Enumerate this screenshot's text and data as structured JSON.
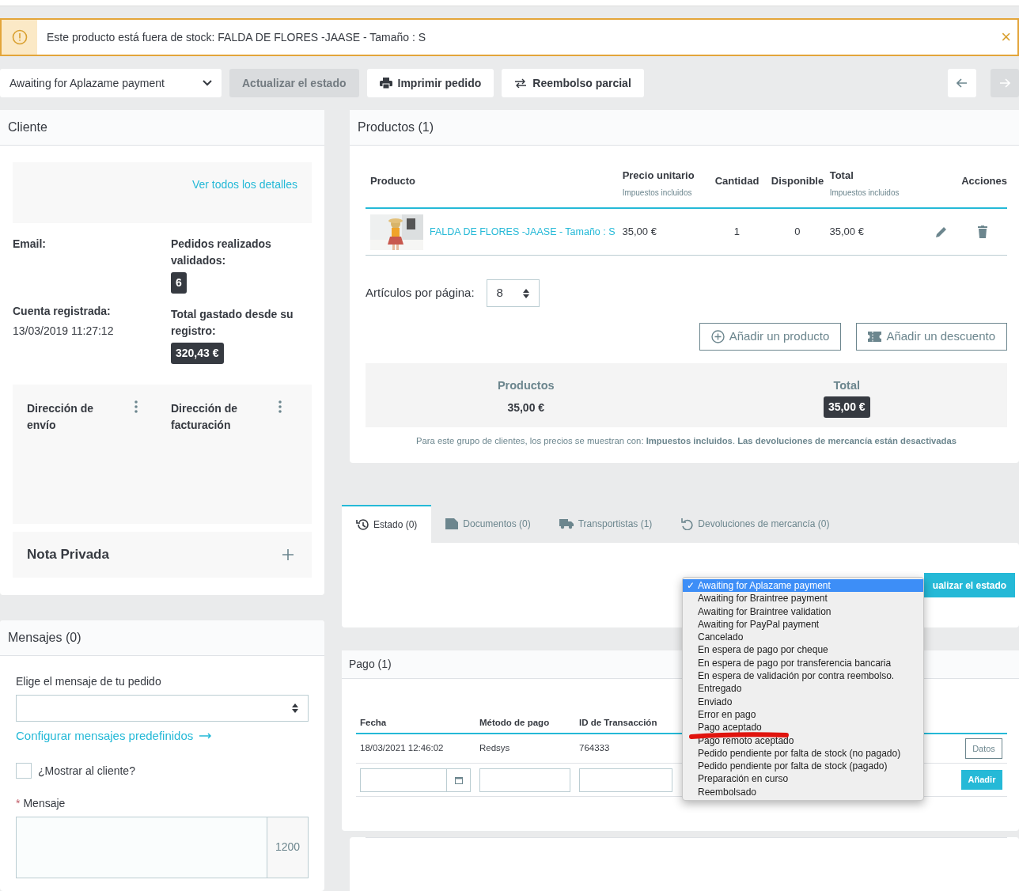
{
  "alert": {
    "text": "Este producto está fuera de stock: FALDA DE FLORES -JAASE - Tamaño : S",
    "close": "×"
  },
  "toolbar": {
    "status_select": "Awaiting for Aplazame payment",
    "update_button": {
      "label": "Actualizar el estado",
      "disabled": true
    },
    "print_button": "Imprimir pedido",
    "refund_button": "Reembolso parcial",
    "nav": [
      {
        "disabled": false
      },
      {
        "disabled": true
      }
    ]
  },
  "customer": {
    "title": "Cliente",
    "details_link": "Ver todos los detalles",
    "email_label": "Email:",
    "registered_label": "Cuenta registrada:",
    "registered_value": "13/03/2019 11:27:12",
    "orders_label": "Pedidos realizados validados:",
    "orders_count": "6",
    "spent_label": "Total gastado desde su registro:",
    "spent_value": "320,43 €",
    "shipping_label": "Dirección de envío",
    "billing_label": "Dirección de facturación",
    "note_label": "Nota Privada"
  },
  "messages": {
    "title": "Mensajes (0)",
    "choose_label": "Elige el mensaje de tu pedido",
    "configure_link": "Configurar mensajes predefinidos",
    "show_customer": {
      "label": "¿Mostrar al cliente?",
      "checked": false
    },
    "required_mark": "*",
    "message_label": "Mensaje",
    "counter": "1200"
  },
  "products": {
    "title": "Productos (1)",
    "columns": [
      {
        "label": "Producto"
      },
      {
        "label": "Precio unitario",
        "sub": "Impuestos incluidos"
      },
      {
        "label": "Cantidad"
      },
      {
        "label": "Disponible"
      },
      {
        "label": "Total",
        "sub": "Impuestos incluidos"
      },
      {
        "label": "Acciones"
      }
    ],
    "rows": [
      {
        "name": "FALDA DE FLORES -JAASE - Tamaño : S",
        "price": "35,00 €",
        "quantity": "1",
        "available": "0",
        "total": "35,00 €"
      }
    ],
    "per_page_label": "Artículos por página:",
    "per_page": "8",
    "add_product": "Añadir un producto",
    "add_discount": "Añadir un descuento",
    "summary": [
      {
        "label": "Productos",
        "value": "35,00 €",
        "kind": "plain"
      },
      {
        "label": "Total",
        "value": "35,00 €",
        "kind": "badge"
      }
    ],
    "note": "Para este grupo de clientes, los precios se muestran con: **Impuestos incluidos**. **Las devoluciones de mercancía están desactivadas**"
  },
  "tabs": [
    {
      "label": "Estado (0)",
      "selected": true
    },
    {
      "label": "Documentos (0)",
      "selected": false
    },
    {
      "label": "Transportistas (1)",
      "selected": false
    },
    {
      "label": "Devoluciones de mercancía (0)",
      "selected": false
    }
  ],
  "status_update_button": "ualizar el estado",
  "status_menu": {
    "selected_mark": "✓",
    "options": [
      {
        "label": "Awaiting for Aplazame payment",
        "selected": true
      },
      {
        "label": "Awaiting for Braintree payment",
        "selected": false
      },
      {
        "label": "Awaiting for Braintree validation",
        "selected": false
      },
      {
        "label": "Awaiting for PayPal payment",
        "selected": false
      },
      {
        "label": "Cancelado",
        "selected": false
      },
      {
        "label": "En espera de pago por cheque",
        "selected": false
      },
      {
        "label": "En espera de pago por transferencia bancaria",
        "selected": false
      },
      {
        "label": "En espera de validación por contra reembolso.",
        "selected": false
      },
      {
        "label": "Entregado",
        "selected": false
      },
      {
        "label": "Enviado",
        "selected": false
      },
      {
        "label": "Error en pago",
        "selected": false
      },
      {
        "label": "Pago aceptado",
        "selected": false
      },
      {
        "label": "Pago remoto aceptado",
        "selected": false
      },
      {
        "label": "Pedido pendiente por falta de stock (no pagado)",
        "selected": false
      },
      {
        "label": "Pedido pendiente por falta de stock (pagado)",
        "selected": false
      },
      {
        "label": "Preparación en curso",
        "selected": false
      },
      {
        "label": "Reembolsado",
        "selected": false
      }
    ]
  },
  "payment": {
    "title": "Pago (1)",
    "columns": [
      "Fecha",
      "Método de pago",
      "ID de Transacción"
    ],
    "rows": [
      {
        "date": "18/03/2021 12:46:02",
        "method": "Redsys",
        "transaction": "764333",
        "details_button": "Datos"
      }
    ],
    "add_button": "Añadir"
  }
}
